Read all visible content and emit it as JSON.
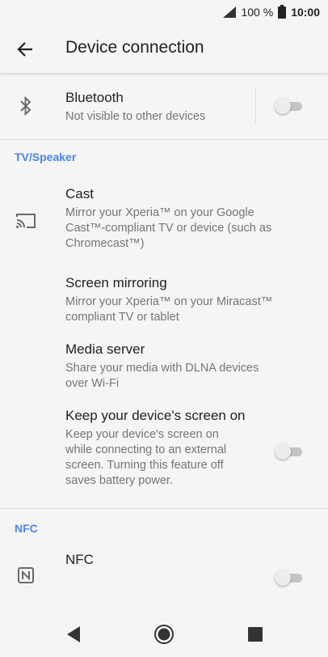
{
  "status_bar": {
    "battery_percent": "100 %",
    "time": "10:00",
    "icons": [
      "signal-icon",
      "battery-icon"
    ]
  },
  "app_bar": {
    "title": "Device connection",
    "back_icon": "back-arrow-icon"
  },
  "bluetooth": {
    "title": "Bluetooth",
    "summary": "Not visible to other devices",
    "icon": "bluetooth-icon",
    "enabled": false
  },
  "sections": {
    "tv_speaker": "TV/Speaker",
    "nfc": "NFC"
  },
  "cast": {
    "title": "Cast",
    "summary": "Mirror your Xperia™ on your Google Cast™-compliant TV or device (such as Chromecast™)",
    "icon": "cast-icon"
  },
  "screen_mirroring": {
    "title": "Screen mirroring",
    "summary": "Mirror your Xperia™ on your Miracast™ compliant TV or tablet"
  },
  "media_server": {
    "title": "Media server",
    "summary": "Share your media with DLNA devices over Wi-Fi"
  },
  "keep_screen_on": {
    "title": "Keep your device's screen on",
    "summary": "Keep your device's screen on while connecting to an external screen. Turning this feature off saves battery power.",
    "enabled": false
  },
  "nfc": {
    "title": "NFC",
    "icon": "nfc-icon",
    "enabled": false
  },
  "nav_bar": {
    "icons": [
      "back-triangle-icon",
      "home-circle-icon",
      "recents-square-icon"
    ]
  },
  "colors": {
    "accent": "#4a86e8",
    "background": "#f5f5f5",
    "secondary_text": "#757575"
  }
}
